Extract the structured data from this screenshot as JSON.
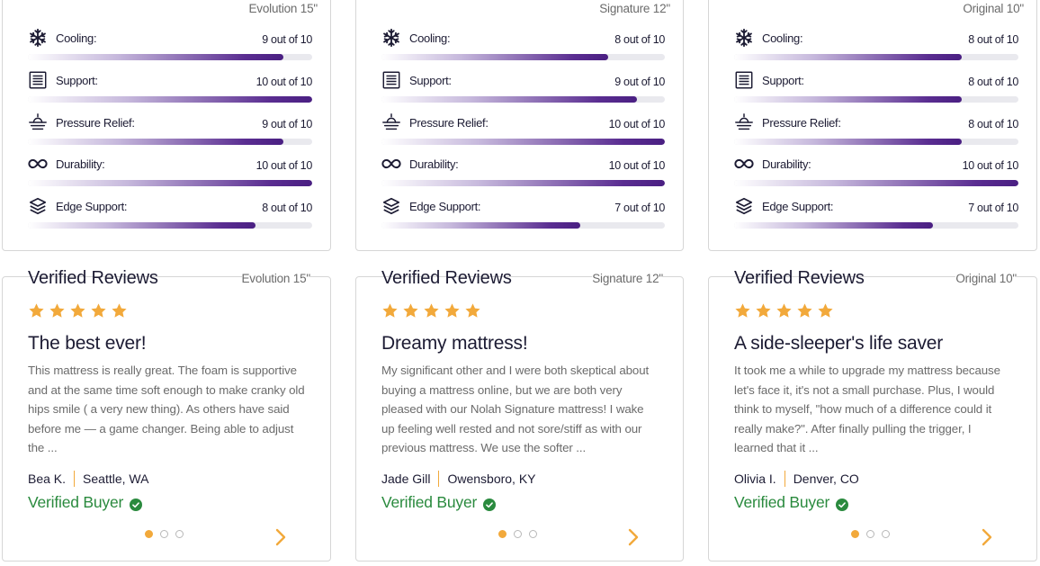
{
  "colors": {
    "accent_purple": "#4a1f82",
    "star_gold": "#f2a93b",
    "verified_green": "#2a8a3e"
  },
  "rating_icons": [
    "snowflake-icon",
    "support-layers-icon",
    "pressure-relief-icon",
    "infinity-icon",
    "edge-stack-icon"
  ],
  "products": [
    {
      "model": "Evolution 15\"",
      "ratings": [
        {
          "label": "Cooling:",
          "score": "9 out of 10",
          "value": 9
        },
        {
          "label": "Support:",
          "score": "10 out of 10",
          "value": 10
        },
        {
          "label": "Pressure Relief:",
          "score": "9 out of 10",
          "value": 9
        },
        {
          "label": "Durability:",
          "score": "10 out of 10",
          "value": 10
        },
        {
          "label": "Edge Support:",
          "score": "8 out of 10",
          "value": 8
        }
      ],
      "reviews": {
        "heading": "Verified Reviews",
        "stars": 5,
        "title": "The best ever!",
        "body": "This mattress is really great. The foam is supportive and at the same time soft enough to make cranky old hips smile ( a very new thing). As others have said before me — a game changer. Being able to adjust the ...",
        "name": "Bea K.",
        "location": "Seattle, WA",
        "verified": "Verified Buyer",
        "page_count": 3,
        "active_page": 1
      }
    },
    {
      "model": "Signature 12\"",
      "ratings": [
        {
          "label": "Cooling:",
          "score": "8 out of 10",
          "value": 8
        },
        {
          "label": "Support:",
          "score": "9 out of 10",
          "value": 9
        },
        {
          "label": "Pressure Relief:",
          "score": "10 out of 10",
          "value": 10
        },
        {
          "label": "Durability:",
          "score": "10 out of 10",
          "value": 10
        },
        {
          "label": "Edge Support:",
          "score": "7 out of 10",
          "value": 7
        }
      ],
      "reviews": {
        "heading": "Verified Reviews",
        "stars": 5,
        "title": "Dreamy mattress!",
        "body": "My significant other and I were both skeptical about buying a mattress online, but we are both very pleased with our Nolah Signature mattress! I wake up feeling well rested and not sore/stiff as with our previous mattress. We use the softer ...",
        "name": "Jade Gill",
        "location": "Owensboro, KY",
        "verified": "Verified Buyer",
        "page_count": 3,
        "active_page": 1
      }
    },
    {
      "model": "Original 10\"",
      "ratings": [
        {
          "label": "Cooling:",
          "score": "8 out of 10",
          "value": 8
        },
        {
          "label": "Support:",
          "score": "8 out of 10",
          "value": 8
        },
        {
          "label": "Pressure Relief:",
          "score": "8 out of 10",
          "value": 8
        },
        {
          "label": "Durability:",
          "score": "10 out of 10",
          "value": 10
        },
        {
          "label": "Edge Support:",
          "score": "7 out of 10",
          "value": 7
        }
      ],
      "reviews": {
        "heading": "Verified Reviews",
        "stars": 5,
        "title": "A side-sleeper's life saver",
        "body": "It took me a while to upgrade my mattress because let's face it, it's not a small purchase. Plus, I would think to myself, \"how much of a difference could it really make?\". After finally pulling the trigger, I learned that it ...",
        "name": "Olivia I.",
        "location": "Denver, CO",
        "verified": "Verified Buyer",
        "page_count": 3,
        "active_page": 1
      }
    }
  ]
}
